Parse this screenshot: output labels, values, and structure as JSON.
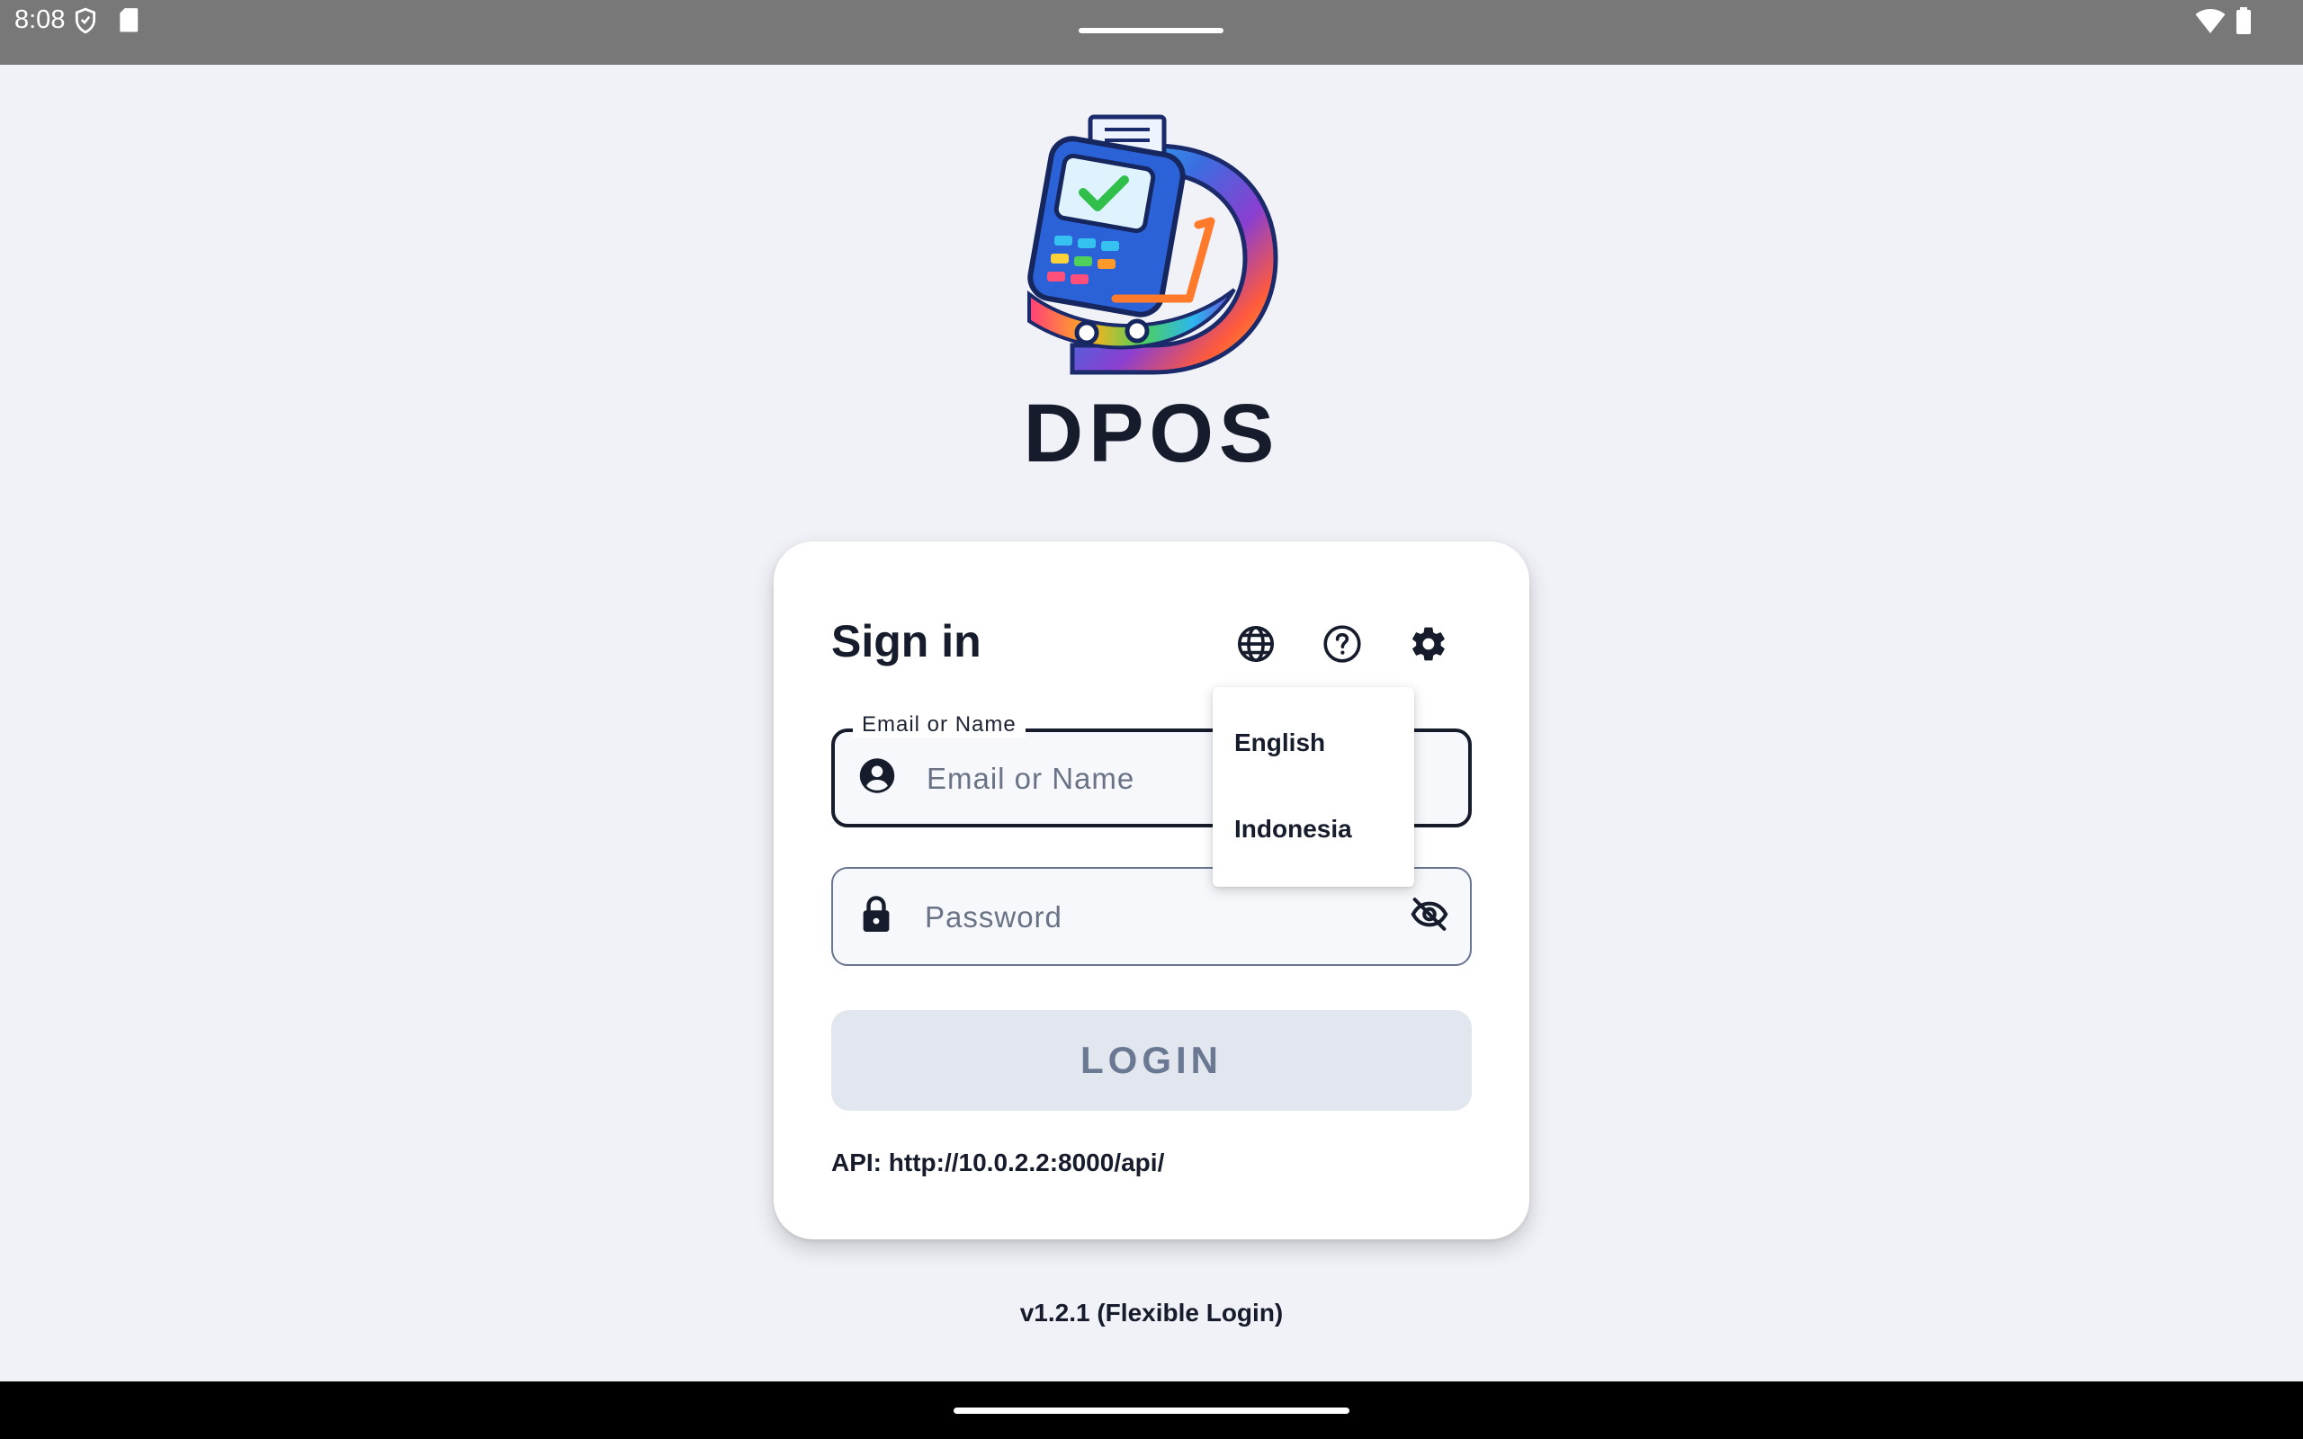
{
  "status_bar": {
    "time": "8:08",
    "left_icons": [
      "shield-icon",
      "sd-card-icon"
    ],
    "right_icons": [
      "wifi-icon",
      "battery-icon"
    ]
  },
  "brand": {
    "name": "DPOS",
    "logo": "pos-terminal-cart-logo"
  },
  "login_card": {
    "title": "Sign in",
    "header_icons": [
      "globe-icon",
      "help-icon",
      "settings-icon"
    ],
    "email_field": {
      "floating_label": "Email or Name",
      "placeholder": "Email or Name",
      "value": "",
      "icon": "account-circle-icon"
    },
    "password_field": {
      "placeholder": "Password",
      "value": "",
      "icon": "lock-icon",
      "toggle_icon": "visibility-off-icon"
    },
    "login_button": "LOGIN",
    "api_text": "API: http://10.0.2.2:8000/api/"
  },
  "language_menu": {
    "items": [
      "English",
      "Indonesia"
    ]
  },
  "footer": {
    "version": "v1.2.1 (Flexible Login)"
  },
  "colors": {
    "background": "#f0f2f7",
    "card": "#ffffff",
    "text": "#161c2b",
    "button_disabled_bg": "#e1e6ef",
    "button_disabled_text": "#6a7891",
    "status_bar": "#787878"
  }
}
